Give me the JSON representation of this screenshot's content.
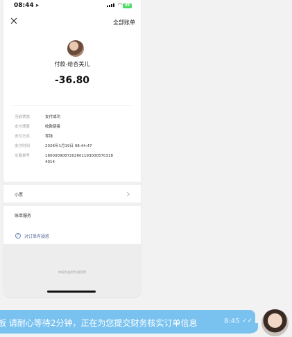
{
  "status_bar": {
    "time": "08:44",
    "battery": "49"
  },
  "header": {
    "all_bills": "全部账单"
  },
  "payment": {
    "payee": "付款-给杏美儿",
    "amount": "-36.80"
  },
  "details": [
    {
      "label": "当前状态",
      "value": "支付成功"
    },
    {
      "label": "支付场景",
      "value": "收款链接"
    },
    {
      "label": "支付方式",
      "value": "零钱"
    },
    {
      "label": "支付时间",
      "value": "2026年1月19日 08:44:47"
    },
    {
      "label": "交易单号",
      "value": "1800009087202601193000570318 4014"
    }
  ],
  "receipt": {
    "label": "小票"
  },
  "bill_service": {
    "title": "账单服务",
    "help_link": "对订单有疑惑"
  },
  "footer": {
    "text": "本服务由财付通提供"
  },
  "chat": {
    "message": "板 请耐心等待2分钟，正在为您提交财务核实订单信息",
    "time": "8:45",
    "read_mark": "✓✓"
  },
  "colors": {
    "bubble": "#79c2f0",
    "link": "#576b95"
  }
}
